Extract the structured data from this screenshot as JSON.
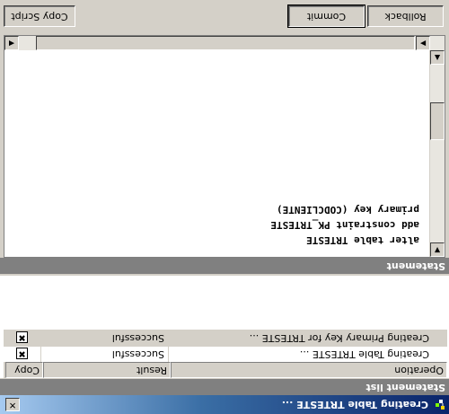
{
  "window": {
    "title": "Creating Table TRTESTE ...",
    "close_glyph": "✕",
    "icon": "tree-nodes-icon"
  },
  "statement_list": {
    "title": "Statement list",
    "columns": [
      "Operation",
      "Result",
      "Copy"
    ],
    "rows": [
      {
        "operation": "Creating Table TRTESTE ...",
        "result": "Successful",
        "copy": "✖"
      },
      {
        "operation": "Creating Primary Key for TRTESTE ...",
        "result": "Successful",
        "copy": "✖"
      }
    ]
  },
  "statement": {
    "title": "Statement",
    "sql_lines": [
      "alter table TRTESTE",
      "add constraint PK_TRTESTE",
      "primary key (CODCLIENTE)"
    ]
  },
  "buttons": {
    "copy_script": "Copy Script",
    "commit": "Commit",
    "rollback": "Rollback"
  },
  "scroll": {
    "up": "▲",
    "down": "▼",
    "left": "◀",
    "right": "▶"
  }
}
